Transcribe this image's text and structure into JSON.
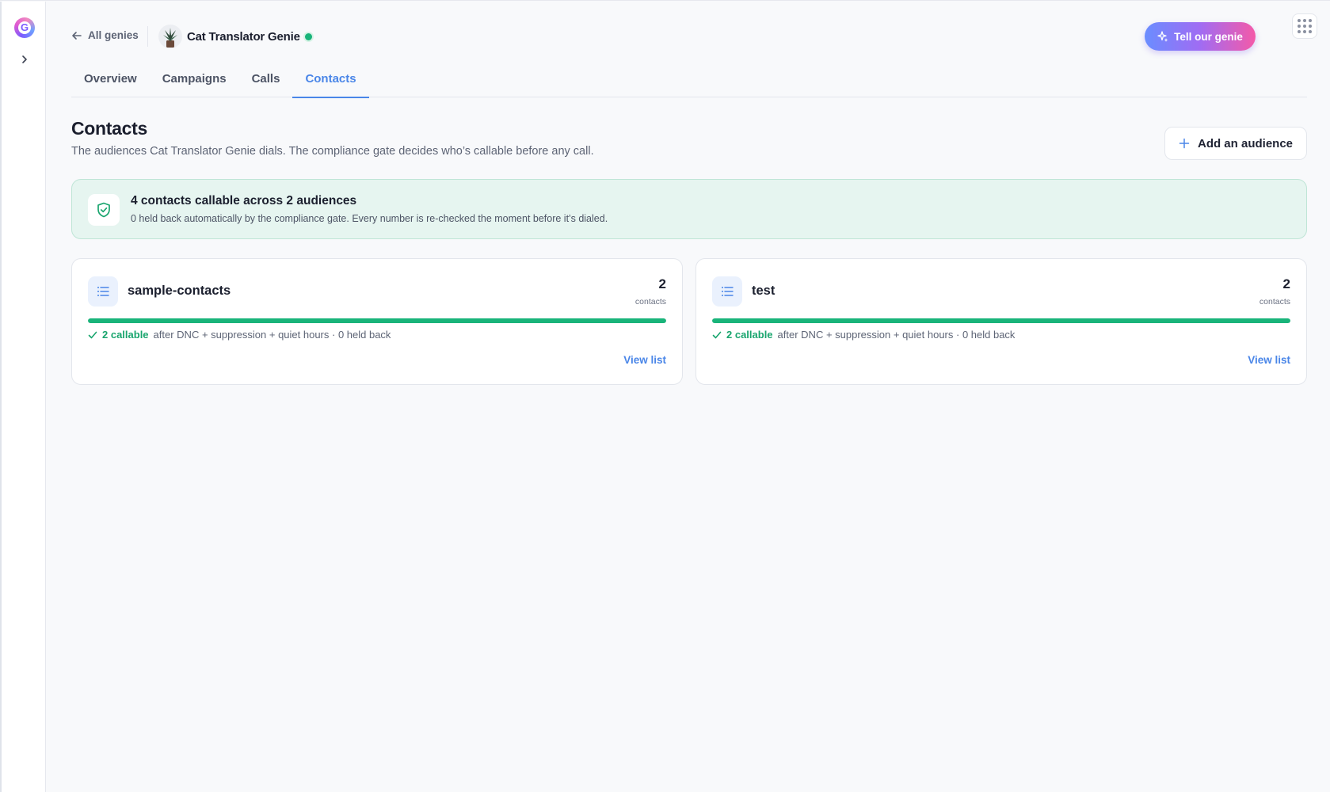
{
  "rail": {
    "logo_letter": "G"
  },
  "header": {
    "back_label": "All genies",
    "genie_name": "Cat Translator Genie",
    "tell_button": "Tell our genie"
  },
  "tabs": [
    {
      "label": "Overview",
      "active": false
    },
    {
      "label": "Campaigns",
      "active": false
    },
    {
      "label": "Calls",
      "active": false
    },
    {
      "label": "Contacts",
      "active": true
    }
  ],
  "page": {
    "title": "Contacts",
    "subtitle": "The audiences Cat Translator Genie dials. The compliance gate decides who’s callable before any call.",
    "add_button": "Add an audience"
  },
  "banner": {
    "title": "4 contacts callable across 2 audiences",
    "subtitle": "0 held back automatically by the compliance gate. Every number is re-checked the moment before it’s dialed."
  },
  "audiences": [
    {
      "name": "sample-contacts",
      "count": "2",
      "count_label": "contacts",
      "callable_fraction": 1.0,
      "callable_label": "2 callable",
      "meta": "after DNC + suppression + quiet hours · 0 held back",
      "view_label": "View list"
    },
    {
      "name": "test",
      "count": "2",
      "count_label": "contacts",
      "callable_fraction": 1.0,
      "callable_label": "2 callable",
      "meta": "after DNC + suppression + quiet hours · 0 held back",
      "view_label": "View list"
    }
  ],
  "colors": {
    "accent": "#4a86e8",
    "success": "#19b47a",
    "banner_bg": "#e6f5f0"
  }
}
